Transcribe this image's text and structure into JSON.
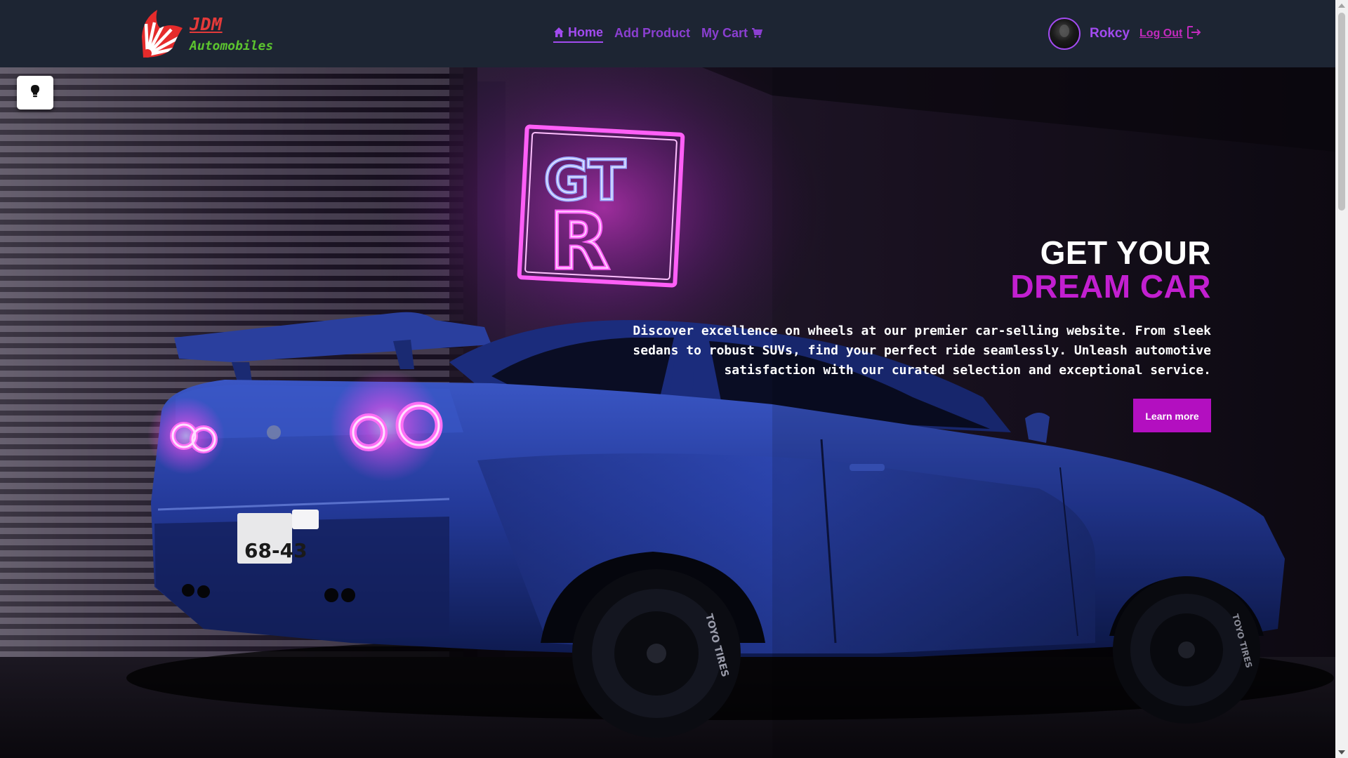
{
  "brand": {
    "title": "JDM",
    "subtitle": "Automobiles",
    "logo_icon": "rising-sun-logo-icon"
  },
  "nav": {
    "items": [
      {
        "label": "Home",
        "icon": "home-icon",
        "active": true
      },
      {
        "label": "Add Product",
        "icon": "",
        "active": false
      },
      {
        "label": "My Cart",
        "icon": "cart-icon",
        "active": false
      }
    ]
  },
  "user": {
    "name": "Rokcy",
    "logout_label": "Log Out",
    "logout_icon": "logout-icon",
    "avatar_icon": "avatar"
  },
  "hero": {
    "title_line1": "GET YOUR",
    "title_line2": "DREAM CAR",
    "description": "Discover excellence on wheels at our premier car-selling website. From sleek sedans to robust SUVs, find your perfect ride seamlessly. Unleash automotive satisfaction with our curated selection and exceptional service.",
    "button_label": "Learn more",
    "neon_sign_text": "GT R",
    "plate_text": "68-43",
    "tire_text": "TOYO TIRES"
  },
  "theme_toggle": {
    "icon": "lightbulb-icon"
  },
  "colors": {
    "navbar_bg": "#1d2533",
    "brand_red": "#e53a3a",
    "brand_green": "#5cc42f",
    "nav_purple": "#a24bf0",
    "logout_magenta": "#c22bbd",
    "hero_accent": "#c21fd0",
    "button_bg": "#b30fc0",
    "neon_pink": "#ff3df5"
  }
}
